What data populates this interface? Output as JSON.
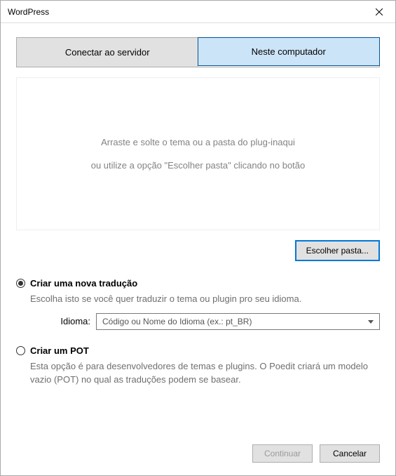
{
  "titlebar": {
    "title": "WordPress"
  },
  "tabs": {
    "connect": "Conectar ao servidor",
    "local": "Neste computador"
  },
  "dropzone": {
    "line1": "Arraste e solte o tema ou a pasta do plug-inaqui",
    "line2": "ou utilize a opção \"Escolher pasta\" clicando no botão"
  },
  "choose_folder_label": "Escolher pasta...",
  "options": {
    "new_translation": {
      "label": "Criar uma nova tradução",
      "desc": "Escolha isto se você quer traduzir o tema ou plugin pro seu idioma.",
      "lang_label": "Idioma:",
      "lang_placeholder": "Código ou Nome do Idioma (ex.: pt_BR)"
    },
    "create_pot": {
      "label": "Criar um POT",
      "desc": "Esta opção é para desenvolvedores de temas e plugins. O Poedit criará um modelo vazio (POT) no qual as traduções podem se basear."
    }
  },
  "buttons": {
    "continue": "Continuar",
    "cancel": "Cancelar"
  }
}
